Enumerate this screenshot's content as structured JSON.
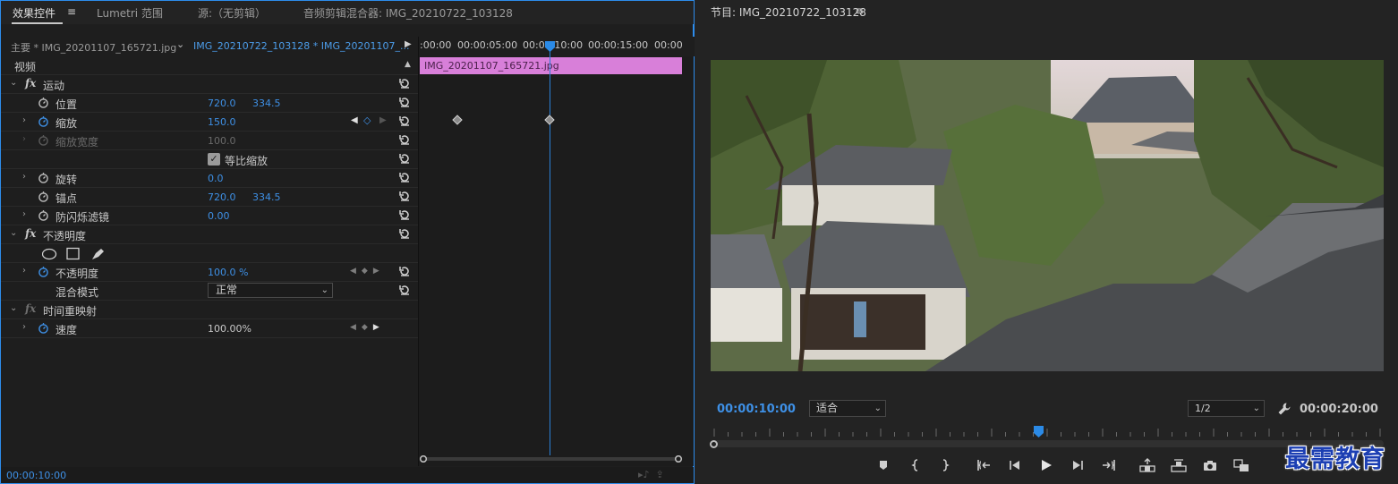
{
  "tabs": {
    "effect_controls": "效果控件",
    "lumetri": "Lumetri 范围",
    "source": "源:（无剪辑）",
    "audio_mixer": "音频剪辑混合器: IMG_20210722_103128",
    "menu_glyph": "≡"
  },
  "clip_header": {
    "master": "主要 * IMG_20201107_165721.jpg",
    "sequence": "IMG_20210722_103128 * IMG_20201107_..."
  },
  "effects": {
    "video_label": "视频",
    "motion": {
      "label": "运动",
      "position": {
        "label": "位置",
        "x": "720.0",
        "y": "334.5"
      },
      "scale": {
        "label": "缩放",
        "value": "150.0"
      },
      "scale_width": {
        "label": "缩放宽度",
        "value": "100.0"
      },
      "uniform_scale": {
        "label": "等比缩放",
        "checked": true
      },
      "rotation": {
        "label": "旋转",
        "value": "0.0"
      },
      "anchor": {
        "label": "锚点",
        "x": "720.0",
        "y": "334.5"
      },
      "anti_flicker": {
        "label": "防闪烁滤镜",
        "value": "0.00"
      }
    },
    "opacity": {
      "label": "不透明度",
      "opacity": {
        "label": "不透明度",
        "value": "100.0 %"
      },
      "blend_mode": {
        "label": "混合模式",
        "value": "正常"
      }
    },
    "time_remap": {
      "label": "时间重映射",
      "speed": {
        "label": "速度",
        "value": "100.00%"
      }
    }
  },
  "timeline": {
    "ticks": [
      ":00:00",
      "00:00:05:00",
      "00:00:10:00",
      "00:00:15:00",
      "00:00"
    ],
    "clip_name": "IMG_20201107_165721.jpg"
  },
  "left_footer_time": "00:00:10:00",
  "program": {
    "title": "节目: IMG_20210722_103128",
    "menu_glyph": "≡",
    "current_time": "00:00:10:00",
    "fit": "适合",
    "resolution": "1/2",
    "duration": "00:00:20:00",
    "playhead_fraction": 0.5
  },
  "watermark": "最需教育",
  "colors": {
    "accent_blue": "#2d8ceb",
    "clip_pink": "#d87fd9",
    "value_blue": "#3e90e6"
  }
}
